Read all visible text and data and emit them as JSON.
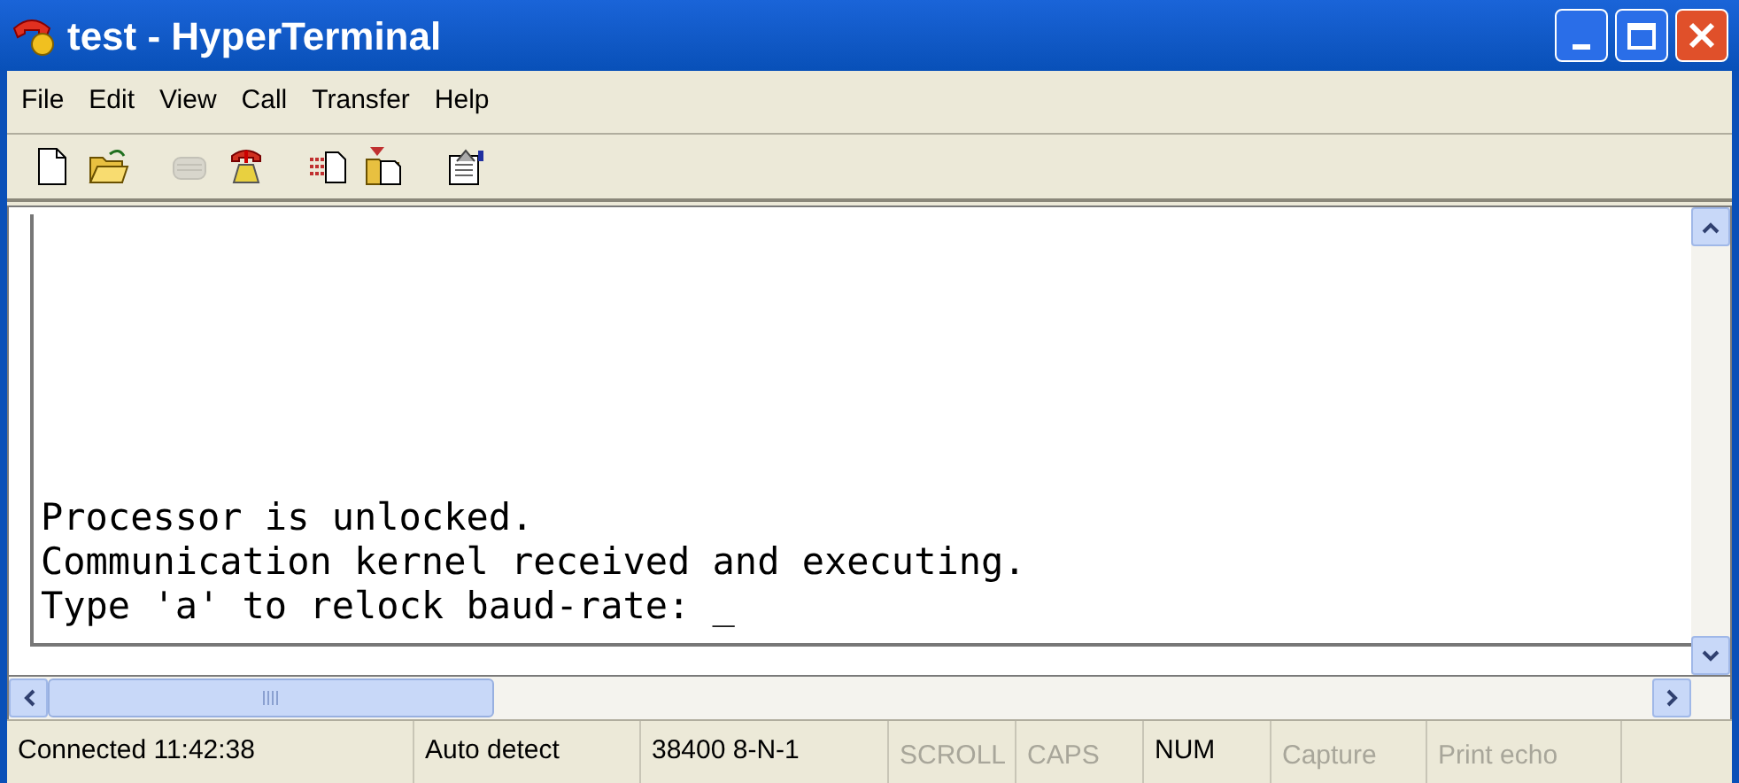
{
  "window": {
    "title": "test - HyperTerminal"
  },
  "menu": [
    "File",
    "Edit",
    "View",
    "Call",
    "Transfer",
    "Help"
  ],
  "toolbar": [
    {
      "kind": "new",
      "disabled": false
    },
    {
      "kind": "open",
      "disabled": false
    },
    {
      "kind": "connect",
      "disabled": true
    },
    {
      "kind": "disconnect",
      "disabled": false
    },
    {
      "kind": "send",
      "disabled": false
    },
    {
      "kind": "receive",
      "disabled": false
    },
    {
      "kind": "properties",
      "disabled": false
    }
  ],
  "terminal": {
    "lines": [
      "Processor is unlocked.",
      "Communication kernel received and executing.",
      "Type 'a' to relock baud-rate: _"
    ]
  },
  "status_bar": [
    {
      "text": "Connected 11:42:38",
      "disabled": false
    },
    {
      "text": "Auto detect",
      "disabled": false
    },
    {
      "text": "38400 8-N-1",
      "disabled": false
    },
    {
      "text": "SCROLL",
      "disabled": true
    },
    {
      "text": "CAPS",
      "disabled": true
    },
    {
      "text": "NUM",
      "disabled": false
    },
    {
      "text": "Capture",
      "disabled": true
    },
    {
      "text": "Print echo",
      "disabled": true
    }
  ]
}
